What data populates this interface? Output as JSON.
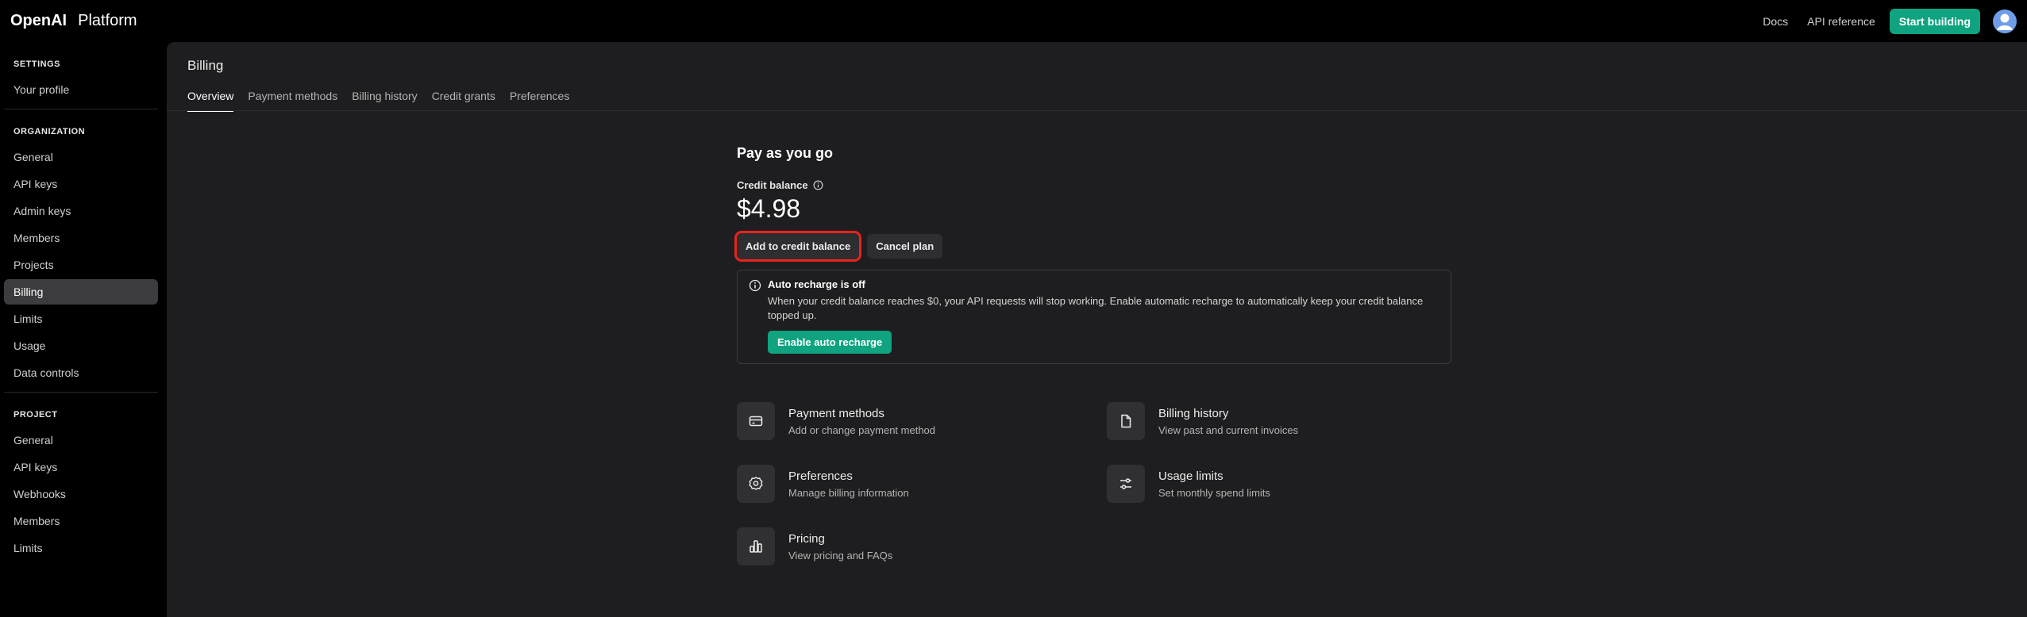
{
  "brand": {
    "name": "OpenAI",
    "product": "Platform"
  },
  "topnav": {
    "docs": "Docs",
    "api_reference": "API reference",
    "start_building": "Start building"
  },
  "sidebar": {
    "settings_header": "SETTINGS",
    "settings_items": [
      "Your profile"
    ],
    "organization_header": "ORGANIZATION",
    "organization_items": [
      "General",
      "API keys",
      "Admin keys",
      "Members",
      "Projects",
      "Billing",
      "Limits",
      "Usage",
      "Data controls"
    ],
    "active_item": "Billing",
    "project_header": "PROJECT",
    "project_items": [
      "General",
      "API keys",
      "Webhooks",
      "Members",
      "Limits"
    ]
  },
  "page": {
    "title": "Billing",
    "tabs": [
      "Overview",
      "Payment methods",
      "Billing history",
      "Credit grants",
      "Preferences"
    ],
    "active_tab": "Overview"
  },
  "billing": {
    "plan_title": "Pay as you go",
    "credit_label": "Credit balance",
    "credit_value": "$4.98",
    "add_credit_label": "Add to credit balance",
    "cancel_plan_label": "Cancel plan",
    "recharge": {
      "title": "Auto recharge is off",
      "text": "When your credit balance reaches $0, your API requests will stop working. Enable automatic recharge to automatically keep your credit balance topped up.",
      "button": "Enable auto recharge"
    },
    "cards": [
      {
        "title": "Payment methods",
        "subtitle": "Add or change payment method",
        "icon": "credit-card-icon"
      },
      {
        "title": "Billing history",
        "subtitle": "View past and current invoices",
        "icon": "document-icon"
      },
      {
        "title": "Preferences",
        "subtitle": "Manage billing information",
        "icon": "gear-icon"
      },
      {
        "title": "Usage limits",
        "subtitle": "Set monthly spend limits",
        "icon": "sliders-icon"
      },
      {
        "title": "Pricing",
        "subtitle": "View pricing and FAQs",
        "icon": "bar-chart-icon"
      }
    ]
  },
  "colors": {
    "accent": "#10a37f",
    "highlight": "#e8231d",
    "main_bg": "#1e1e20",
    "sidebar_active": "#3c3c3f"
  }
}
